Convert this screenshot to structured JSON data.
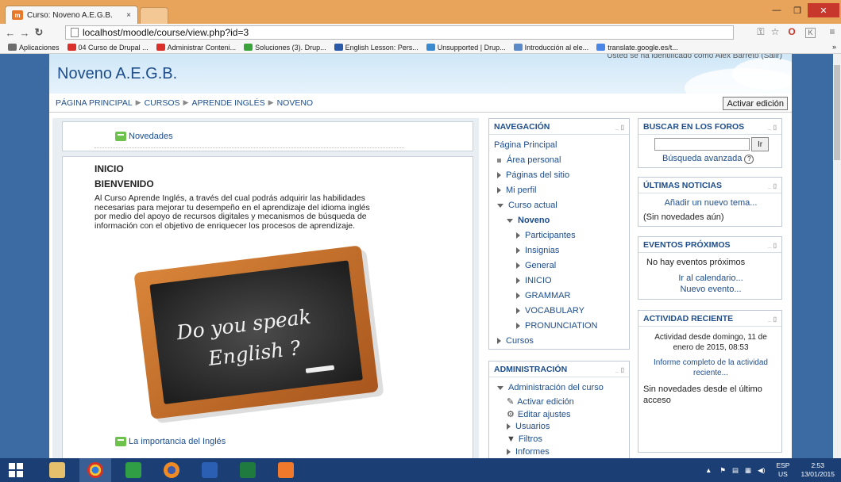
{
  "browser": {
    "tab_title": "Curso: Noveno A.E.G.B.",
    "tab_close": "×",
    "url": "localhost/moodle/course/view.php?id=3",
    "bookmarks": [
      {
        "label": "Aplicaciones",
        "color": "#6d6d6d"
      },
      {
        "label": "04 Curso de Drupal ...",
        "color": "#d9302b"
      },
      {
        "label": "Administrar Conteni...",
        "color": "#d9302b"
      },
      {
        "label": "Soluciones (3). Drup...",
        "color": "#3aa33a"
      },
      {
        "label": "English Lesson: Pers...",
        "color": "#2a5aa8"
      },
      {
        "label": "Unsupported | Drup...",
        "color": "#3a8ad0"
      },
      {
        "label": "Introducción al ele...",
        "color": "#5a8ac8"
      },
      {
        "label": "translate.google.es/t...",
        "color": "#4a86e8"
      }
    ],
    "bookmarks_more": "»"
  },
  "page": {
    "site_title": "Noveno A.E.G.B.",
    "logged_in": "Usted se ha identificado como Alex Barreto (Salir)",
    "breadcrumb": [
      "PÁGINA PRINCIPAL",
      "CURSOS",
      "APRENDE INGLÉS",
      "NOVENO"
    ],
    "edit_button": "Activar edición"
  },
  "main": {
    "news_forum": "Novedades",
    "section_title": "INICIO",
    "welcome": "BIENVENIDO",
    "description_lines": [
      "Al Curso Aprende Inglés, a través del cual podrás adquirir las habilidades",
      "necesarias para mejorar tu desempeño en el aprendizaje del idioma inglés",
      "por medio del apoyo de recursos digitales y mecanismos de búsqueda de",
      "información con el objetivo de enriquecer los procesos de aprendizaje."
    ],
    "chalkboard_line1": "Do you speak",
    "chalkboard_line2": "English ?",
    "forum2": "La importancia del Inglés"
  },
  "navigation": {
    "title": "NAVEGACIÓN",
    "items": [
      "Página Principal",
      "Área personal",
      "Páginas del sitio",
      "Mi perfil",
      "Curso actual",
      "Noveno",
      "Participantes",
      "Insignias",
      "General",
      "INICIO",
      "GRAMMAR",
      "VOCABULARY",
      "PRONUNCIATION",
      "Cursos"
    ]
  },
  "admin": {
    "title": "ADMINISTRACIÓN",
    "items": [
      "Administración del curso",
      "Activar edición",
      "Editar ajustes",
      "Usuarios",
      "Filtros",
      "Informes"
    ]
  },
  "search_forums": {
    "title": "BUSCAR EN LOS FOROS",
    "button": "Ir",
    "advanced": "Búsqueda avanzada",
    "help": "?"
  },
  "latest_news": {
    "title": "ÚLTIMAS NOTICIAS",
    "add": "Añadir un nuevo tema...",
    "empty": "(Sin novedades aún)"
  },
  "upcoming": {
    "title": "EVENTOS PRÓXIMOS",
    "empty": "No hay eventos próximos",
    "calendar": "Ir al calendario...",
    "new_event": "Nuevo evento..."
  },
  "recent": {
    "title": "ACTIVIDAD RECIENTE",
    "since_l1": "Actividad desde domingo, 11 de",
    "since_l2": "enero de 2015, 08:53",
    "report_l1": "Informe completo de la actividad",
    "report_l2": "reciente...",
    "none_l1": "Sin novedades desde el último",
    "none_l2": "acceso"
  },
  "taskbar": {
    "lang_top": "ESP",
    "lang_bottom": "US",
    "time": "2:53",
    "date": "13/01/2015"
  },
  "colors": {
    "accent": "#1d4d8c",
    "tab_bar": "#e9a45b",
    "taskbar": "#1b3f74"
  }
}
